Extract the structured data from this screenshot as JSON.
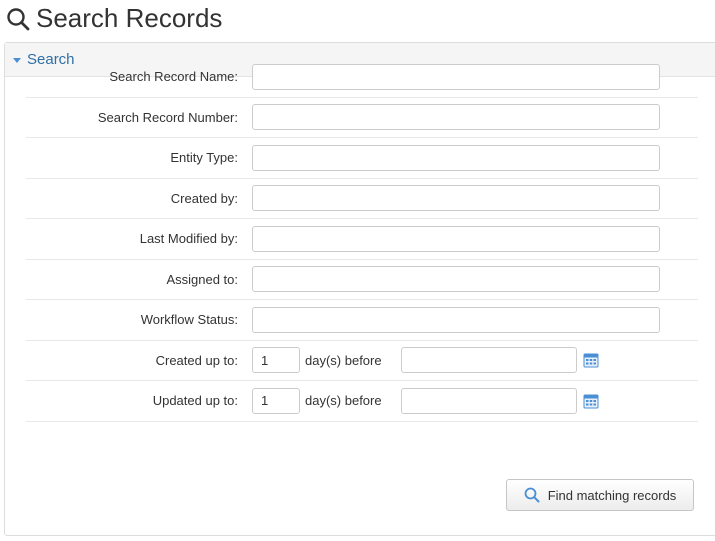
{
  "page": {
    "title": "Search Records"
  },
  "panel": {
    "header": "Search"
  },
  "fields": [
    {
      "label": "Search Record Name:",
      "value": ""
    },
    {
      "label": "Search Record Number:",
      "value": ""
    },
    {
      "label": "Entity Type:",
      "value": ""
    },
    {
      "label": "Created by:",
      "value": ""
    },
    {
      "label": "Last Modified by:",
      "value": ""
    },
    {
      "label": "Assigned to:",
      "value": ""
    },
    {
      "label": "Workflow Status:",
      "value": ""
    }
  ],
  "date_fields": [
    {
      "label": "Created up to:",
      "days": "1",
      "days_suffix": "day(s) before",
      "date": ""
    },
    {
      "label": "Updated up to:",
      "days": "1",
      "days_suffix": "day(s) before",
      "date": ""
    }
  ],
  "actions": {
    "find_label": "Find matching records"
  },
  "colors": {
    "accent": "#2f6fa7",
    "icon_blue": "#4a8fd4",
    "border": "#cccccc"
  },
  "icons": {
    "title": "search-icon",
    "button": "search-icon",
    "date_picker": "calendar-icon",
    "panel_toggle": "caret-down-icon"
  }
}
